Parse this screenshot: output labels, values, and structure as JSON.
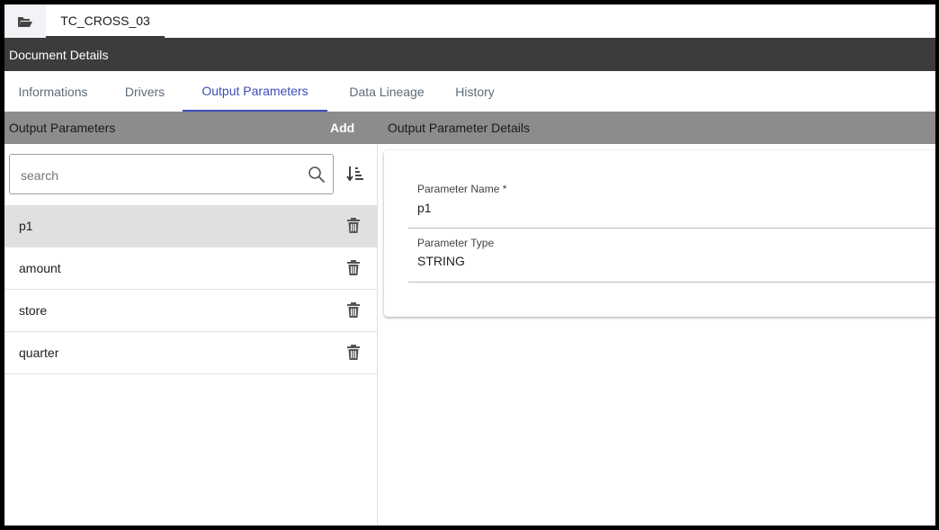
{
  "header": {
    "document_tab_title": "TC_CROSS_03",
    "toolbar_title": "Document Details"
  },
  "tabs": [
    {
      "label": "Informations",
      "active": false
    },
    {
      "label": "Drivers",
      "active": false
    },
    {
      "label": "Output Parameters",
      "active": true
    },
    {
      "label": "Data Lineage",
      "active": false
    },
    {
      "label": "History",
      "active": false
    }
  ],
  "section": {
    "left_title": "Output Parameters",
    "add_label": "Add",
    "right_title": "Output Parameter Details"
  },
  "search": {
    "placeholder": "search",
    "value": ""
  },
  "parameters": [
    {
      "name": "p1",
      "selected": true
    },
    {
      "name": "amount",
      "selected": false
    },
    {
      "name": "store",
      "selected": false
    },
    {
      "name": "quarter",
      "selected": false
    }
  ],
  "details": {
    "name_label": "Parameter Name *",
    "name_value": "p1",
    "type_label": "Parameter Type",
    "type_value": "STRING"
  },
  "icons": {
    "folder": "folder-open-icon",
    "search": "search-icon",
    "sort": "sort-icon",
    "delete": "trash-icon"
  },
  "colors": {
    "accent": "#3b4cb8",
    "toolbar_bg": "#3c3c3c",
    "section_bg": "#8c8c8c",
    "selected_row": "#e0e0e0"
  }
}
